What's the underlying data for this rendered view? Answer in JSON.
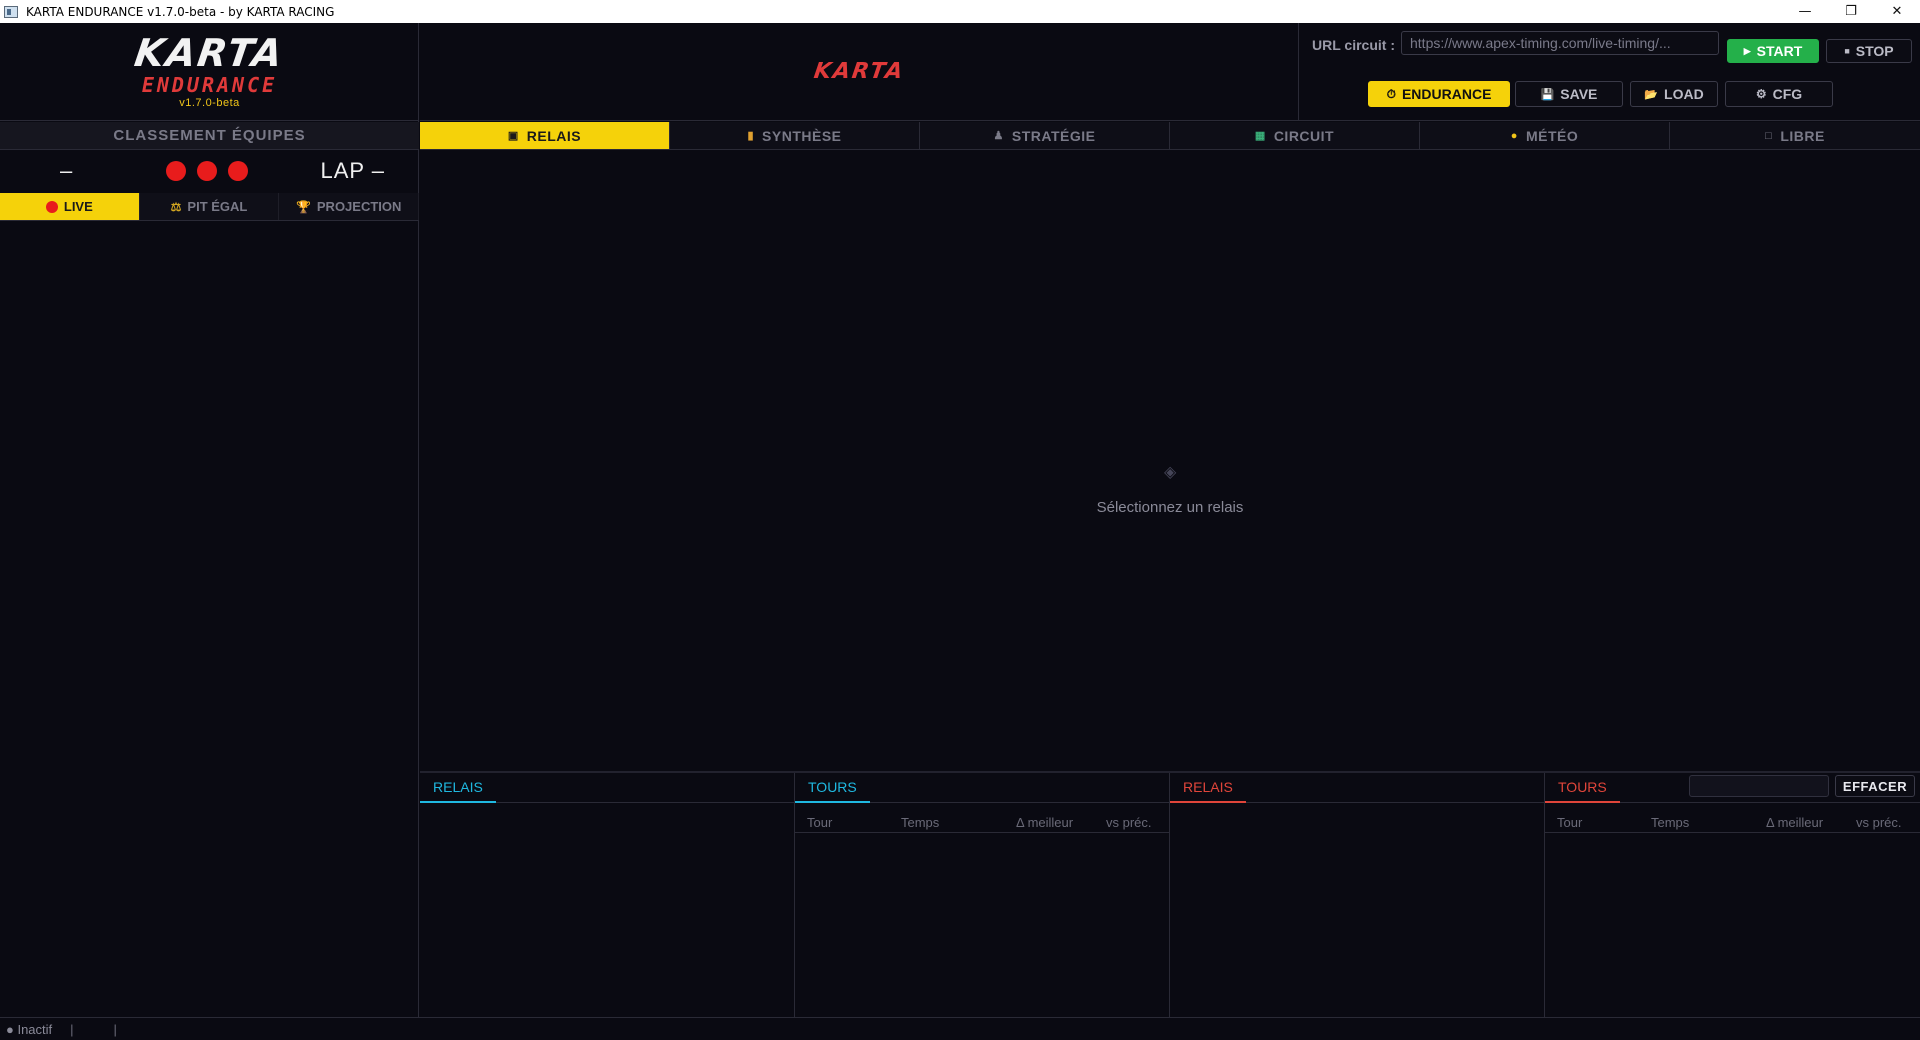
{
  "window": {
    "title": "KARTA ENDURANCE v1.7.0-beta - by KARTA RACING",
    "minimize": "—",
    "maximize": "❐",
    "close": "✕"
  },
  "logo": {
    "karta": "KARTA",
    "endurance": "ENDURANCE",
    "version": "v1.7.0-beta"
  },
  "header": {
    "brand": "KARTA",
    "url_label": "URL circuit :",
    "url_value": "https://www.apex-timing.com/live-timing/...",
    "start": "START",
    "stop": "STOP",
    "endurance": "ENDURANCE",
    "save": "SAVE",
    "load": "LOAD",
    "cfg": "CFG"
  },
  "sidebar": {
    "title": "CLASSEMENT ÉQUIPES",
    "race_position": "–",
    "lap_label": "LAP –",
    "lights": [
      "#e81c1c",
      "#e81c1c",
      "#e81c1c"
    ],
    "modes": [
      {
        "label": "LIVE",
        "active": true
      },
      {
        "label": "PIT ÉGAL",
        "active": false
      },
      {
        "label": "PROJECTION",
        "active": false
      }
    ]
  },
  "tabs": [
    {
      "label": "RELAIS",
      "icon": "relay-icon",
      "active": true
    },
    {
      "label": "SYNTHÈSE",
      "icon": "chart-icon",
      "active": false
    },
    {
      "label": "STRATÉGIE",
      "icon": "pawn-icon",
      "active": false
    },
    {
      "label": "CIRCUIT",
      "icon": "map-icon",
      "active": false
    },
    {
      "label": "MÉTÉO",
      "icon": "sun-icon",
      "active": false
    },
    {
      "label": "LIBRE",
      "icon": "square-icon",
      "active": false
    }
  ],
  "main": {
    "empty_message": "Sélectionnez un relais"
  },
  "bottom": {
    "panels": [
      {
        "tab": "RELAIS",
        "color": "#1fb8e0"
      },
      {
        "tab": "TOURS",
        "color": "#1fb8e0",
        "columns": [
          "Tour",
          "Temps",
          "Δ meilleur",
          "vs préc."
        ]
      },
      {
        "tab": "RELAIS",
        "color": "#e0453a"
      },
      {
        "tab": "TOURS",
        "color": "#e0453a",
        "columns": [
          "Tour",
          "Temps",
          "Δ meilleur",
          "vs préc."
        ],
        "clear": "EFFACER"
      }
    ]
  },
  "status": {
    "text": "● Inactif",
    "sep1": "|",
    "sep2": "|"
  },
  "colors": {
    "accent": "#f5d20a",
    "start": "#24b04a",
    "brand_red": "#e03a3a",
    "cyan": "#1fb8e0"
  }
}
